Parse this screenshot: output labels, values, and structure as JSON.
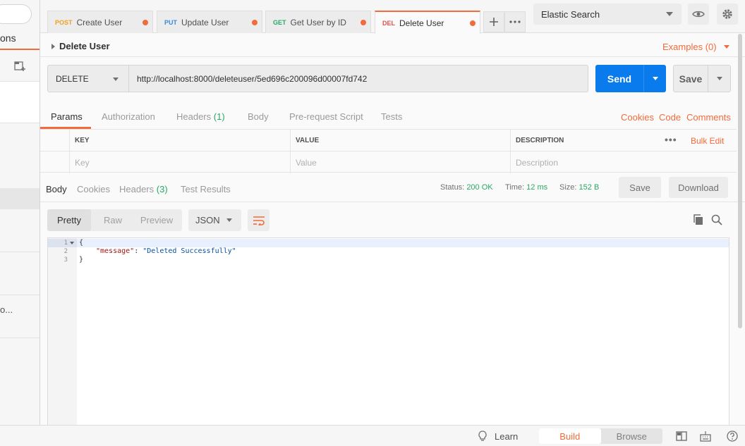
{
  "sidebar": {
    "tab_label": "ons",
    "truncated_item": "o..."
  },
  "tabs": [
    {
      "method": "POST",
      "label": "Create User"
    },
    {
      "method": "PUT",
      "label": "Update User"
    },
    {
      "method": "GET",
      "label": "Get User by ID"
    },
    {
      "method": "DEL",
      "label": "Delete User"
    }
  ],
  "environment": {
    "selected": "Elastic Search"
  },
  "request": {
    "name": "Delete User",
    "examples_label": "Examples (0)",
    "method": "DELETE",
    "url": "http://localhost:8000/deleteuser/5ed696c200096d00007fd742",
    "send_label": "Send",
    "save_label": "Save"
  },
  "request_tabs": {
    "params": "Params",
    "authorization": "Authorization",
    "headers": "Headers",
    "headers_count": "(1)",
    "body": "Body",
    "prerequest": "Pre-request Script",
    "tests": "Tests",
    "cookies": "Cookies",
    "code": "Code",
    "comments": "Comments"
  },
  "params_table": {
    "headers": {
      "key": "KEY",
      "value": "VALUE",
      "description": "DESCRIPTION"
    },
    "bulk_edit": "Bulk Edit",
    "placeholders": {
      "key": "Key",
      "value": "Value",
      "description": "Description"
    }
  },
  "response_tabs": {
    "body": "Body",
    "cookies": "Cookies",
    "headers": "Headers",
    "headers_count": "(3)",
    "test_results": "Test Results"
  },
  "response_meta": {
    "status_label": "Status:",
    "status_value": "200 OK",
    "time_label": "Time:",
    "time_value": "12 ms",
    "size_label": "Size:",
    "size_value": "152 B",
    "save_label": "Save",
    "download_label": "Download"
  },
  "body_toolbar": {
    "formats": [
      "Pretty",
      "Raw",
      "Preview"
    ],
    "active_format": "Pretty",
    "language": "JSON"
  },
  "response_body": {
    "line_numbers": [
      "1",
      "2",
      "3"
    ],
    "open_brace": "{",
    "key": "\"message\"",
    "colon": ": ",
    "value": "\"Deleted Successfully\"",
    "close_brace": "}"
  },
  "footer": {
    "learn": "Learn",
    "build": "Build",
    "browse": "Browse"
  },
  "colors": {
    "accent": "#f26b3a",
    "send": "#097bed",
    "success": "#27a964"
  }
}
